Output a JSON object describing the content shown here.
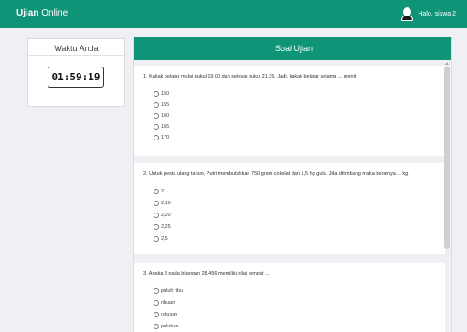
{
  "navbar": {
    "brand_bold": "Ujian",
    "brand_rest": " Online",
    "user_greeting": "Halo, siswa 2",
    "user_icon": "user-icon"
  },
  "timer": {
    "title": "Waktu Anda",
    "value": "01:59:19"
  },
  "exam": {
    "title": "Soal Ujian",
    "questions": [
      {
        "text": "1.   Kakak belajar mulai pukul 19.00 dan selesai pukul 21.35. Jadi, kakak belajar selama ... menit",
        "options": [
          "150",
          "155",
          "160",
          "165",
          "170"
        ]
      },
      {
        "text": "2.   Untuk pesta ulang tahun, Putri membutuhkan 750 gram cokelat dan 1,5 hg gula. Jika ditimbang maka beratnya ... kg.",
        "options": [
          "2",
          "2,10",
          "2,20",
          "2,25",
          "2,5"
        ]
      },
      {
        "text": "3.   Angka 8 pada bilangan 28.456 memiliki nilai tempat ...",
        "options": [
          "puluh ribu",
          "ribuan",
          "ratusan",
          "puluhan"
        ]
      }
    ]
  },
  "colors": {
    "accent": "#0f9478",
    "background": "#eef0f3"
  }
}
